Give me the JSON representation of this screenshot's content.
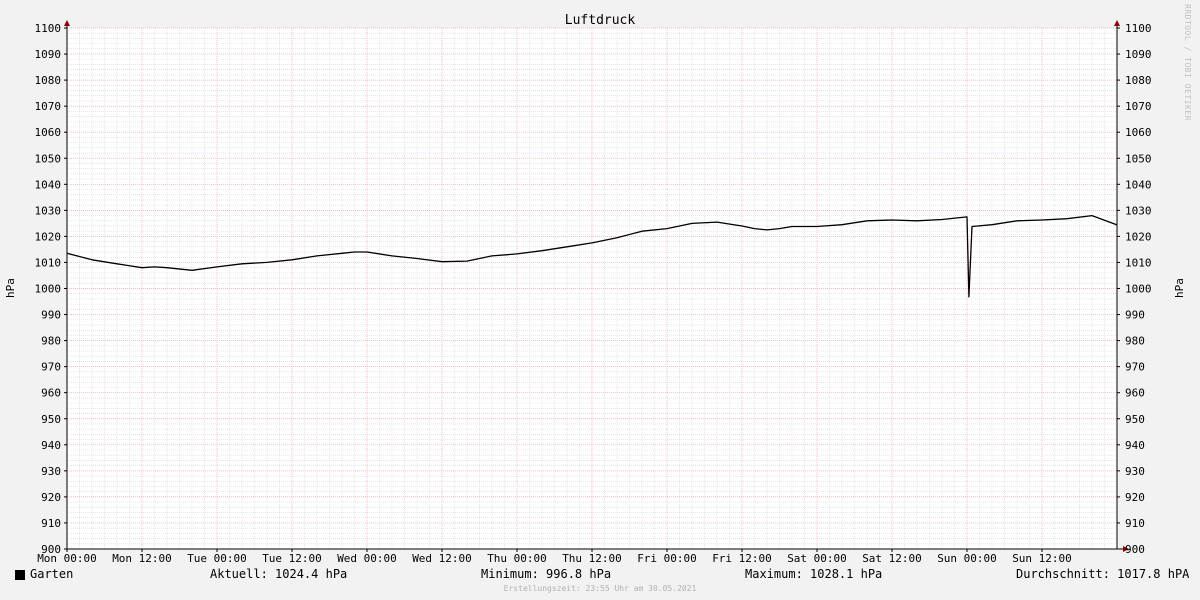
{
  "chart_data": {
    "type": "line",
    "title": "Luftdruck",
    "ylabel": "hPa",
    "ylim": [
      900,
      1100
    ],
    "yticks": [
      900,
      910,
      920,
      930,
      940,
      950,
      960,
      970,
      980,
      990,
      1000,
      1010,
      1020,
      1030,
      1040,
      1050,
      1060,
      1070,
      1080,
      1090,
      1100
    ],
    "xticks": [
      "Mon 00:00",
      "Mon 12:00",
      "Tue 00:00",
      "Tue 12:00",
      "Wed 00:00",
      "Wed 12:00",
      "Thu 00:00",
      "Thu 12:00",
      "Fri 00:00",
      "Fri 12:00",
      "Sat 00:00",
      "Sat 12:00",
      "Sun 00:00",
      "Sun 12:00"
    ],
    "xunit": "hours since Mon 00:00",
    "xlim": [
      0,
      168
    ],
    "grid": true,
    "series": [
      {
        "name": "Garten",
        "color": "#000000",
        "x": [
          0,
          4,
          8,
          12,
          14,
          16,
          20,
          24,
          28,
          32,
          36,
          40,
          44,
          46,
          48,
          52,
          56,
          60,
          64,
          68,
          72,
          76,
          80,
          84,
          88,
          92,
          96,
          100,
          104,
          108,
          110,
          112,
          114,
          116,
          120,
          124,
          128,
          132,
          136,
          140,
          144,
          144.3,
          144.8,
          148,
          152,
          156,
          160,
          164,
          168
        ],
        "values": [
          1013.5,
          1011,
          1009.5,
          1008,
          1008.3,
          1008,
          1007,
          1008.3,
          1009.5,
          1010,
          1011,
          1012.5,
          1013.5,
          1014,
          1014,
          1012.5,
          1011.5,
          1010.3,
          1010.5,
          1012.5,
          1013.3,
          1014.5,
          1016,
          1017.5,
          1019.5,
          1022,
          1023,
          1025,
          1025.5,
          1024,
          1023,
          1022.5,
          1023,
          1023.8,
          1023.8,
          1024.5,
          1026,
          1026.3,
          1026,
          1026.5,
          1027.5,
          996.8,
          1023.8,
          1024.5,
          1026,
          1026.3,
          1026.8,
          1028,
          1024.4
        ]
      }
    ]
  },
  "legend": {
    "series_name": "Garten",
    "aktuell": "Aktuell: 1024.4 hPa",
    "minimum": "Minimum: 996.8 hPa",
    "maximum": "Maximum: 1028.1 hPa",
    "durchschnitt": "Durchschnitt: 1017.8 hPA"
  },
  "footer": "Erstellungszeit: 23:55 Uhr am 30.05.2021",
  "watermark": "RRDTOOL / TOBI OETIKER",
  "colors": {
    "background": "#f2f2f2",
    "plot_background": "#ffffff",
    "major_grid": "#f2a6a6",
    "minor_grid": "#d8d8d8",
    "axis": "#000000",
    "arrow": "#8b0000"
  }
}
